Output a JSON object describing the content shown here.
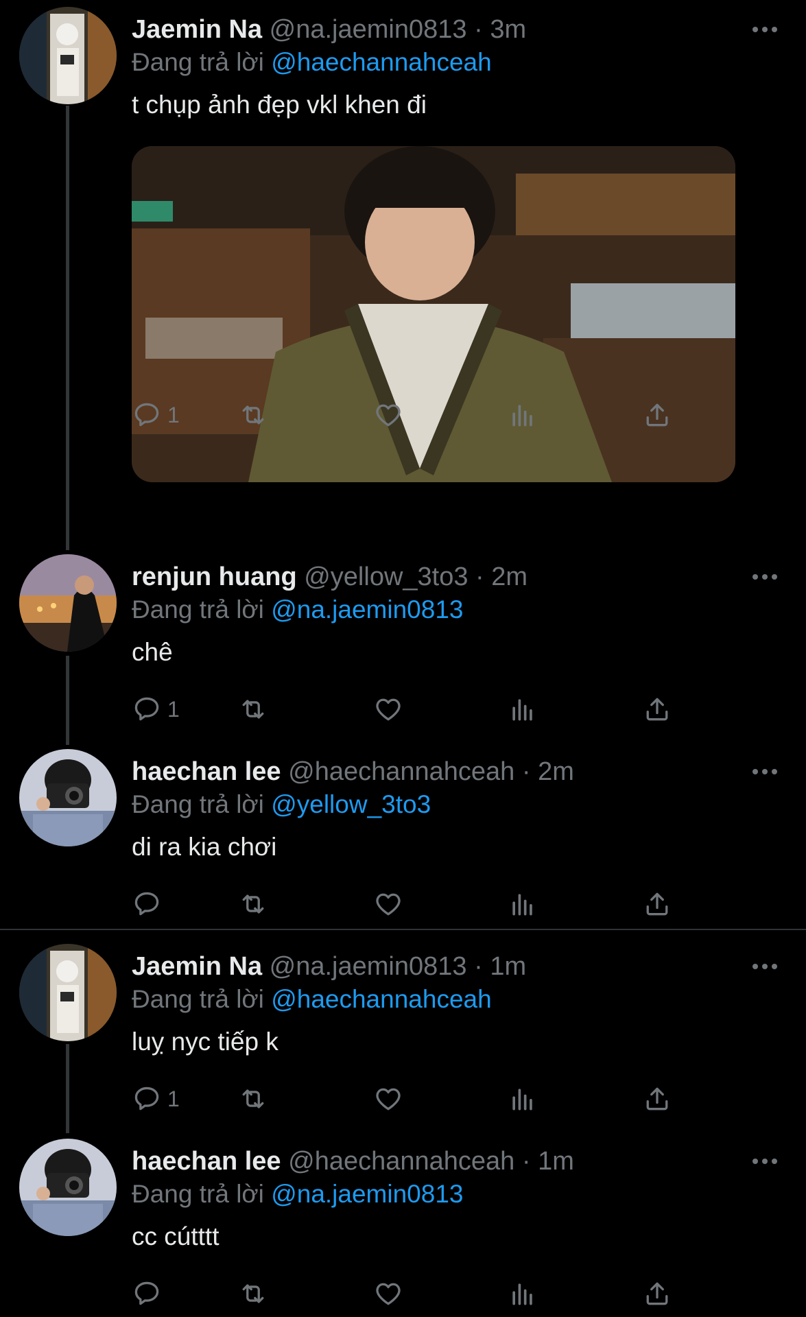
{
  "tweets": [
    {
      "name": "Jaemin Na",
      "handle": "@na.jaemin0813",
      "time": "3m",
      "replying_label": "Đang trả lời",
      "replying_to": "@haechannahceah",
      "text": "t chụp ảnh đẹp vkl khen đi",
      "reply_count": "1",
      "has_media": true
    },
    {
      "name": "renjun huang",
      "handle": "@yellow_3to3",
      "time": "2m",
      "replying_label": "Đang trả lời",
      "replying_to": "@na.jaemin0813",
      "text": "chê",
      "reply_count": "1"
    },
    {
      "name": "haechan lee",
      "handle": "@haechannahceah",
      "time": "2m",
      "replying_label": "Đang trả lời",
      "replying_to": "@yellow_3to3",
      "text": "di ra kia chơi",
      "reply_count": ""
    },
    {
      "name": "Jaemin Na",
      "handle": "@na.jaemin0813",
      "time": "1m",
      "replying_label": "Đang trả lời",
      "replying_to": "@haechannahceah",
      "text": "luỵ nyc tiếp k",
      "reply_count": "1"
    },
    {
      "name": "haechan lee",
      "handle": "@haechannahceah",
      "time": "1m",
      "replying_label": "Đang trả lời",
      "replying_to": "@na.jaemin0813",
      "text": "cc cútttt",
      "reply_count": ""
    }
  ],
  "separator": " · ",
  "icons": {
    "reply": "reply-icon",
    "retweet": "retweet-icon",
    "like": "heart-icon",
    "views": "analytics-icon",
    "share": "share-icon",
    "more": "more-icon"
  },
  "colors": {
    "background": "#000000",
    "text": "#e7e9ea",
    "secondary": "#71767b",
    "link": "#1d9bf0",
    "divider": "#2f3336"
  }
}
